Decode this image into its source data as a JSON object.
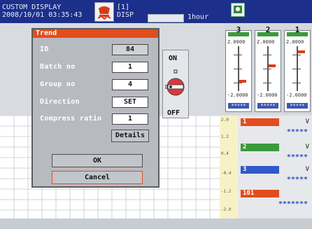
{
  "header": {
    "title": "CUSTOM DISPLAY",
    "datetime": "2008/10/01 03:35:43",
    "group_index": "[1]",
    "disp_label": "DISP",
    "time_span": "1hour"
  },
  "dialog": {
    "title": "Trend",
    "fields": [
      {
        "label": "ID",
        "value": "84"
      },
      {
        "label": "Batch no",
        "value": "1"
      },
      {
        "label": "Group no",
        "value": "4"
      },
      {
        "label": "Direction",
        "value": "SET"
      },
      {
        "label": "Compress ratio",
        "value": "1"
      }
    ],
    "details_button": "Details",
    "ok_button": "OK",
    "cancel_button": "Cancel"
  },
  "switch": {
    "on_label": "ON",
    "off_label": "OFF"
  },
  "meters": [
    {
      "channel": "3",
      "top": "2.0000",
      "bottom": "-2.0000",
      "readout": "*****"
    },
    {
      "channel": "2",
      "top": "2.0000",
      "bottom": "-2.0000",
      "readout": "*****"
    },
    {
      "channel": "1",
      "top": "2.0000",
      "bottom": "-2.0000",
      "readout": "*****"
    }
  ],
  "scale_labels": [
    "2.0",
    "1.2",
    "0.4",
    "-0.4",
    "-1.2",
    "-2.0"
  ],
  "digital": [
    {
      "channel": "1",
      "color": "#e34c1c",
      "unit": "V",
      "value": "*****"
    },
    {
      "channel": "2",
      "color": "#3a9a3c",
      "unit": "V",
      "value": "*****"
    },
    {
      "channel": "3",
      "color": "#2f58c9",
      "unit": "V",
      "value": "*****"
    },
    {
      "channel": "101",
      "color": "#e34c1c",
      "unit": "",
      "value": "*******"
    }
  ],
  "colors": {
    "header_bg": "#1c2f8a",
    "dialog_title_bg": "#e34c1c",
    "readout_blue": "#2e4fbf"
  },
  "icons": {
    "header_alarm": "alarm-bell-icon",
    "header_status": "status-monitor-icon",
    "switch_knob": "rotary-switch-icon"
  }
}
